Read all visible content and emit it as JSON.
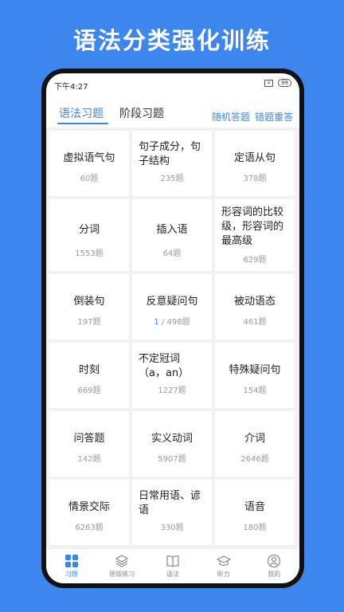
{
  "banner": {
    "title": "语法分类强化训练"
  },
  "status": {
    "time": "下午4:27",
    "battery": "99"
  },
  "tabs": [
    {
      "label": "语法习题",
      "active": true
    },
    {
      "label": "阶段习题",
      "active": false
    }
  ],
  "actions": {
    "random": "随机答题",
    "mistakes": "错题重答"
  },
  "categories": [
    {
      "title": "虚拟语气句",
      "count": "60题"
    },
    {
      "title": "句子成分，句子结构",
      "count": "235题"
    },
    {
      "title": "定语从句",
      "count": "378题"
    },
    {
      "title": "分词",
      "count": "1553题"
    },
    {
      "title": "插入语",
      "count": "64题"
    },
    {
      "title": "形容词的比较级，形容词的最高级",
      "count": "629题"
    },
    {
      "title": "倒装句",
      "count": "197题"
    },
    {
      "title": "反意疑问句",
      "done": "1",
      "count": " / 498题"
    },
    {
      "title": "被动语态",
      "count": "461题"
    },
    {
      "title": "时刻",
      "count": "669题"
    },
    {
      "title": "不定冠词（a，an）",
      "count": "1227题"
    },
    {
      "title": "特殊疑问句",
      "count": "154题"
    },
    {
      "title": "问答题",
      "count": "142题"
    },
    {
      "title": "实义动词",
      "count": "5907题"
    },
    {
      "title": "介词",
      "count": "2646题"
    },
    {
      "title": "情景交际",
      "count": "6263题"
    },
    {
      "title": "日常用语、谚语",
      "count": "330题"
    },
    {
      "title": "语音",
      "count": "180题"
    }
  ],
  "nav": [
    {
      "label": "习题",
      "icon": "grid-icon",
      "active": true
    },
    {
      "label": "原版练习",
      "icon": "layers-icon",
      "active": false
    },
    {
      "label": "语法",
      "icon": "book-icon",
      "active": false
    },
    {
      "label": "听力",
      "icon": "graduation-cap-icon",
      "active": false
    },
    {
      "label": "我的",
      "icon": "user-icon",
      "active": false
    }
  ],
  "colors": {
    "accent": "#3d86ee",
    "background": "#3d86ee"
  }
}
